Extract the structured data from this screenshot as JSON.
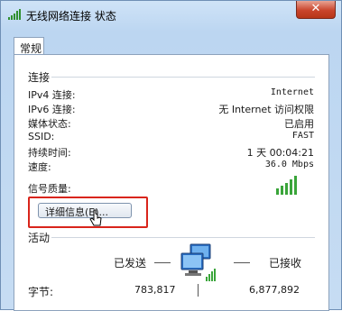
{
  "window": {
    "title": "无线网络连接 状态",
    "close_label": "✕"
  },
  "tabs": [
    {
      "label": "常规"
    }
  ],
  "connection": {
    "section_label": "连接",
    "rows": [
      {
        "label": "IPv4 连接:",
        "value": "Internet"
      },
      {
        "label": "IPv6 连接:",
        "value": "无 Internet 访问权限"
      },
      {
        "label": "媒体状态:",
        "value": "已启用"
      },
      {
        "label": "SSID:",
        "value": "FAST"
      },
      {
        "label": "持续时间:",
        "value": "1 天 00:04:21"
      },
      {
        "label": "速度:",
        "value": "36.0 Mbps"
      }
    ],
    "signal_label": "信号质量:",
    "signal_bars_filled": 5,
    "signal_bars_total": 5,
    "details_button": "详细信息(E)..."
  },
  "activity": {
    "section_label": "活动",
    "sent_label": "已发送",
    "received_label": "已接收",
    "bytes_label": "字节:",
    "bytes_sent": "783,817",
    "bytes_received": "6,877,892"
  },
  "colors": {
    "highlight": "#d9251b",
    "signal": "#3aa53a"
  },
  "icons": [
    "wifi-signal-icon",
    "close-icon",
    "signal-quality-icon",
    "mouse-cursor-icon",
    "network-computers-icon"
  ]
}
